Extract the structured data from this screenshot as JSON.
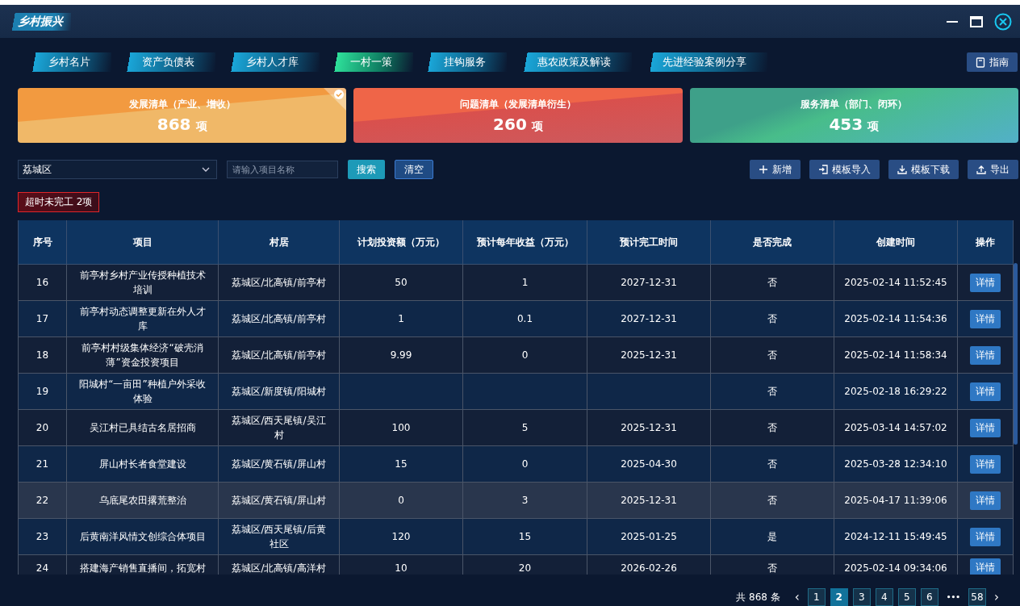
{
  "window": {
    "title": "乡村振兴"
  },
  "tabs": [
    {
      "label": "乡村名片",
      "selected": false
    },
    {
      "label": "资产负债表",
      "selected": false
    },
    {
      "label": "乡村人才库",
      "selected": false
    },
    {
      "label": "一村一策",
      "selected": true
    },
    {
      "label": "挂钩服务",
      "selected": false
    },
    {
      "label": "惠农政策及解读",
      "selected": false
    },
    {
      "label": "先进经验案例分享",
      "selected": false
    }
  ],
  "guide_button": "指南",
  "cards": [
    {
      "kind": "orange",
      "title": "发展清单（产业、增收）",
      "count": "868",
      "unit": "项",
      "selected": true
    },
    {
      "kind": "red",
      "title": "问题清单（发展清单衍生）",
      "count": "260",
      "unit": "项",
      "selected": false
    },
    {
      "kind": "green",
      "title": "服务清单（部门、闭环）",
      "count": "453",
      "unit": "项",
      "selected": false
    }
  ],
  "filters": {
    "district": "荔城区",
    "search": {
      "placeholder": "请输入项目名称"
    },
    "search_button": "搜索",
    "clear_button": "清空"
  },
  "actions": [
    {
      "kind": "add",
      "label": "新增"
    },
    {
      "kind": "import",
      "label": "模板导入"
    },
    {
      "kind": "download",
      "label": "模板下载"
    },
    {
      "kind": "export",
      "label": "导出"
    }
  ],
  "overdue_badge": "超时未完工 2项",
  "table": {
    "columns": [
      "序号",
      "项目",
      "村居",
      "计划投资额（万元）",
      "预计每年收益（万元）",
      "预计完工时间",
      "是否完成",
      "创建时间",
      "操作"
    ],
    "rows": [
      {
        "cells": [
          "16",
          "前亭村乡村产业传授种植技术培训",
          "荔城区/北高镇/前亭村",
          "50",
          "1",
          "2027-12-31",
          "否",
          "2025-02-14 11:52:45"
        ],
        "action": "详情",
        "highlighted": false
      },
      {
        "cells": [
          "17",
          "前亭村动态调整更新在外人才库",
          "荔城区/北高镇/前亭村",
          "1",
          "0.1",
          "2027-12-31",
          "否",
          "2025-02-14 11:54:36"
        ],
        "action": "详情",
        "highlighted": false
      },
      {
        "cells": [
          "18",
          "前亭村村级集体经济“破壳消薄”资金投资项目",
          "荔城区/北高镇/前亭村",
          "9.99",
          "0",
          "2025-12-31",
          "否",
          "2025-02-14 11:58:34"
        ],
        "action": "详情",
        "highlighted": false
      },
      {
        "cells": [
          "19",
          "阳城村“一亩田”种植户外采收体验",
          "荔城区/新度镇/阳城村",
          "",
          "",
          "",
          "否",
          "2025-02-18 16:29:22"
        ],
        "action": "详情",
        "highlighted": false
      },
      {
        "cells": [
          "20",
          "吴江村已具结古名居招商",
          "荔城区/西天尾镇/吴江村",
          "100",
          "5",
          "2025-12-31",
          "否",
          "2025-03-14 14:57:02"
        ],
        "action": "详情",
        "highlighted": false
      },
      {
        "cells": [
          "21",
          "屏山村长者食堂建设",
          "荔城区/黄石镇/屏山村",
          "15",
          "0",
          "2025-04-30",
          "否",
          "2025-03-28 12:34:10"
        ],
        "action": "详情",
        "highlighted": false
      },
      {
        "cells": [
          "22",
          "乌底尾农田撂荒整治",
          "荔城区/黄石镇/屏山村",
          "0",
          "3",
          "2025-12-31",
          "否",
          "2025-04-17 11:39:06"
        ],
        "action": "详情",
        "highlighted": true
      },
      {
        "cells": [
          "23",
          "后黄南洋风情文创综合体项目",
          "荔城区/西天尾镇/后黄社区",
          "120",
          "15",
          "2025-01-25",
          "是",
          "2024-12-11 15:49:45"
        ],
        "action": "详情",
        "highlighted": false
      },
      {
        "cells": [
          "24",
          "搭建海产销售直播间，拓宽村",
          "荔城区/北高镇/高洋村",
          "10",
          "20",
          "2026-02-26",
          "否",
          "2025-02-14 09:34:06"
        ],
        "action": "详情",
        "highlighted": false
      }
    ]
  },
  "pagination": {
    "total": "共 868 条",
    "prev": "‹",
    "next": "›",
    "ellipsis": "•••",
    "pages": [
      {
        "label": "1",
        "selected": false
      },
      {
        "label": "2",
        "selected": true
      },
      {
        "label": "3",
        "selected": false
      },
      {
        "label": "4",
        "selected": false
      },
      {
        "label": "5",
        "selected": false
      },
      {
        "label": "6",
        "selected": false
      },
      {
        "label": "58",
        "selected": false
      }
    ]
  }
}
